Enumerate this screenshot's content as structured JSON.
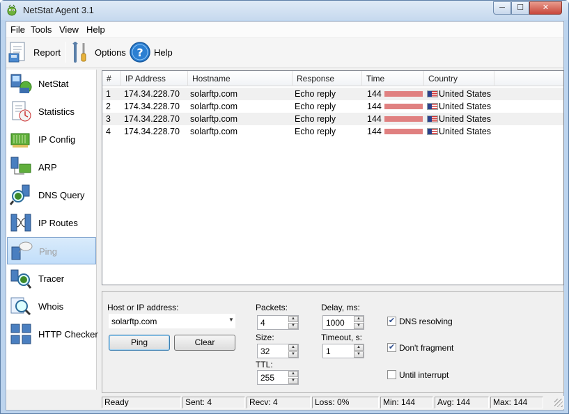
{
  "window": {
    "title": "NetStat Agent 3.1",
    "minimize": "─",
    "maximize": "☐",
    "close": "✕"
  },
  "menu": {
    "file": "File",
    "tools": "Tools",
    "view": "View",
    "help": "Help"
  },
  "toolbar": {
    "report": "Report",
    "options": "Options",
    "help": "Help"
  },
  "sidebar": {
    "items": [
      {
        "label": "NetStat",
        "icon": "netstat-icon"
      },
      {
        "label": "Statistics",
        "icon": "statistics-icon"
      },
      {
        "label": "IP Config",
        "icon": "ip-config-icon"
      },
      {
        "label": "ARP",
        "icon": "arp-icon"
      },
      {
        "label": "DNS Query",
        "icon": "dns-query-icon"
      },
      {
        "label": "IP Routes",
        "icon": "ip-routes-icon"
      },
      {
        "label": "Ping",
        "icon": "ping-icon",
        "active": true
      },
      {
        "label": "Tracer",
        "icon": "tracer-icon"
      },
      {
        "label": "Whois",
        "icon": "whois-icon"
      },
      {
        "label": "HTTP Checker",
        "icon": "http-checker-icon"
      }
    ]
  },
  "table": {
    "columns": [
      "#",
      "IP Address",
      "Hostname",
      "Response",
      "Time",
      "Country"
    ],
    "rows": [
      {
        "n": "1",
        "ip": "174.34.228.70",
        "host": "solarftp.com",
        "response": "Echo reply",
        "time": "144",
        "country": "United States"
      },
      {
        "n": "2",
        "ip": "174.34.228.70",
        "host": "solarftp.com",
        "response": "Echo reply",
        "time": "144",
        "country": "United States"
      },
      {
        "n": "3",
        "ip": "174.34.228.70",
        "host": "solarftp.com",
        "response": "Echo reply",
        "time": "144",
        "country": "United States"
      },
      {
        "n": "4",
        "ip": "174.34.228.70",
        "host": "solarftp.com",
        "response": "Echo reply",
        "time": "144",
        "country": "United States"
      }
    ]
  },
  "form": {
    "host_label": "Host or IP address:",
    "host_value": "solarftp.com",
    "ping_button": "Ping",
    "clear_button": "Clear",
    "packets_label": "Packets:",
    "packets_value": "4",
    "size_label": "Size:",
    "size_value": "32",
    "ttl_label": "TTL:",
    "ttl_value": "255",
    "delay_label": "Delay, ms:",
    "delay_value": "1000",
    "timeout_label": "Timeout, s:",
    "timeout_value": "1",
    "dns_resolving": {
      "label": "DNS resolving",
      "checked": true
    },
    "dont_fragment": {
      "label": "Don't fragment",
      "checked": true
    },
    "until_interrupt": {
      "label": "Until interrupt",
      "checked": false
    }
  },
  "statusbar": {
    "state": "Ready",
    "sent": "Sent: 4",
    "recv": "Recv: 4",
    "loss": "Loss: 0%",
    "min": "Min: 144",
    "avg": "Avg: 144",
    "max": "Max: 144"
  },
  "colors": {
    "time_bar": "#e08080",
    "selection": "#c2defa"
  }
}
